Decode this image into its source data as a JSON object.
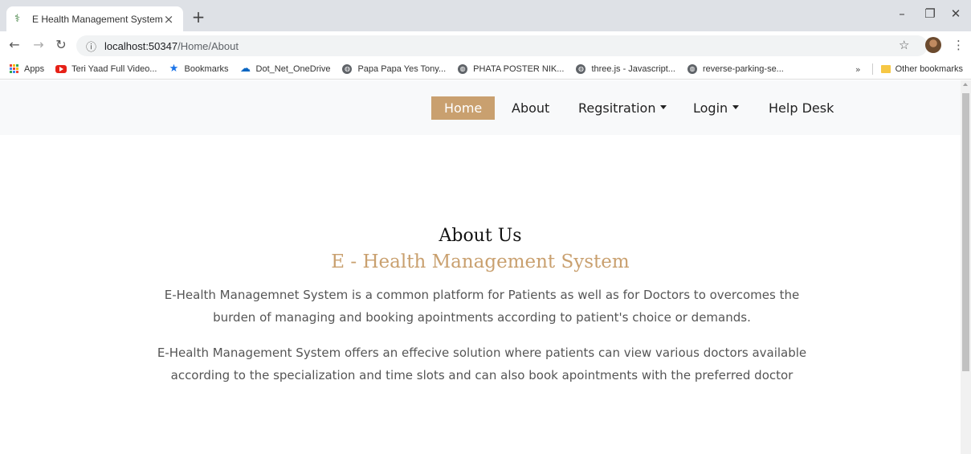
{
  "browser": {
    "tab_title": "E Health Management System",
    "url_host": "localhost:50347",
    "url_path": "/Home/About",
    "bookmarks": [
      {
        "label": "Apps",
        "icon": "apps-grid-icon"
      },
      {
        "label": "Teri Yaad Full Video...",
        "icon": "youtube-icon"
      },
      {
        "label": "Bookmarks",
        "icon": "star-icon"
      },
      {
        "label": "Dot_Net_OneDrive",
        "icon": "cloud-icon"
      },
      {
        "label": "Papa Papa Yes Tony...",
        "icon": "globe-icon"
      },
      {
        "label": "PHATA POSTER NIK...",
        "icon": "globe-icon"
      },
      {
        "label": "three.js - Javascript...",
        "icon": "globe-icon"
      },
      {
        "label": "reverse-parking-se...",
        "icon": "globe-icon"
      }
    ],
    "other_bookmarks": "Other bookmarks"
  },
  "nav": {
    "home": "Home",
    "about": "About",
    "registration": "Regsitration",
    "login": "Login",
    "help": "Help Desk"
  },
  "content": {
    "title": "About Us",
    "subtitle": "E - Health Management System",
    "para1": "E-Health Managemnet System is a common platform for Patients as well as for Doctors to overcomes the burden of managing and booking apointments according to patient's choice or demands.",
    "para2": "E-Health Management System offers an effecive solution where patients can view various doctors available according to the specialization and time slots and can also book apointments with the preferred doctor"
  },
  "colors": {
    "accent": "#c9a06f",
    "navbar_bg": "#f8f9fa"
  }
}
